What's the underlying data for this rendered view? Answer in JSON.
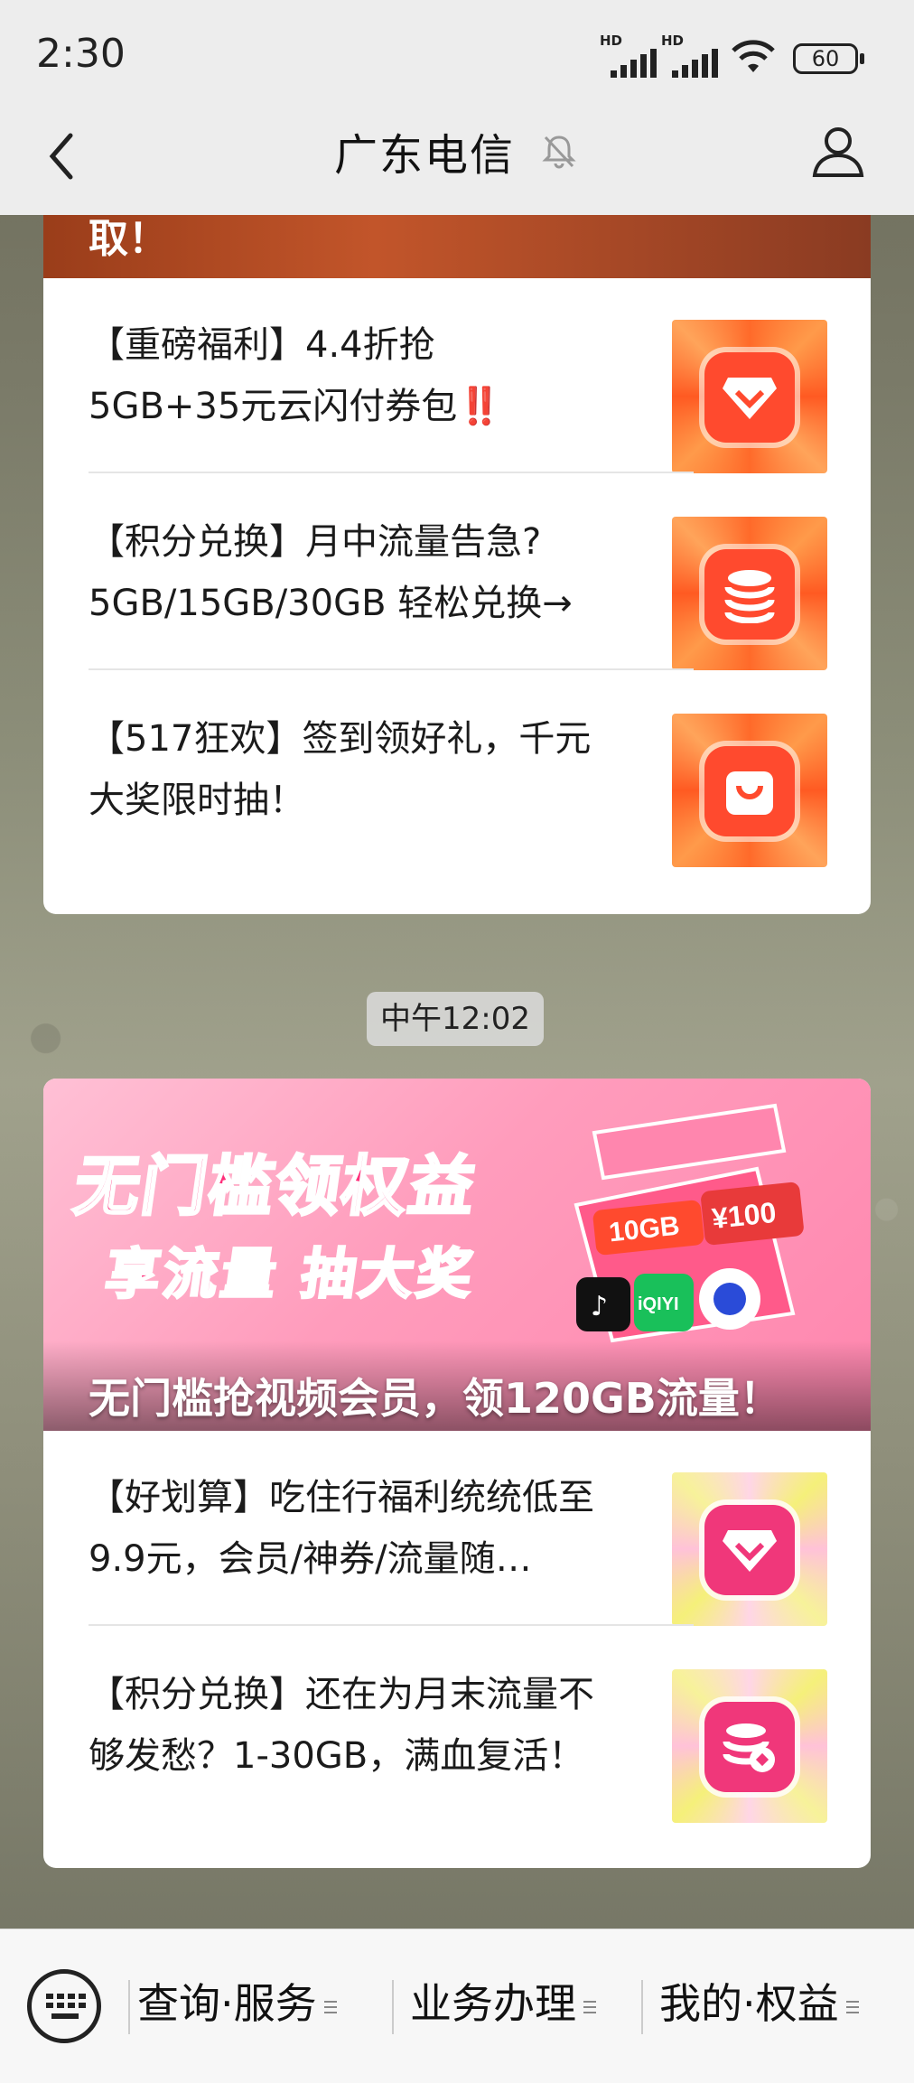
{
  "status_bar": {
    "time": "2:30",
    "signal1_label": "HD",
    "signal2_label": "HD",
    "battery": "60"
  },
  "header": {
    "title": "广东电信",
    "back_icon": "chevron-left-icon",
    "mute_icon": "bell-muted-icon",
    "profile_icon": "user-icon"
  },
  "card1": {
    "top_fragment": "取！",
    "items": [
      {
        "text": "【重磅福利】4.4折抢5GB+35元云闪付券包‼️",
        "line1": "【重磅福利】4.4折抢",
        "line2": "5GB+35元云闪付券包‼️",
        "thumb_icon": "diamond-coupon-icon"
      },
      {
        "text": "【积分兑换】月中流量告急？5GB/15GB/30GB轻松兑换→",
        "line1": "【积分兑换】月中流量告急?",
        "line2": "5GB/15GB/30GB 轻松兑换→",
        "thumb_icon": "coin-stack-icon"
      },
      {
        "text": "【517狂欢】签到领好礼，千元大奖限时抽！",
        "line1": "【517狂欢】签到领好礼，千元",
        "line2": "大奖限时抽！",
        "thumb_icon": "shopping-bag-icon"
      }
    ]
  },
  "timestamp": "中午12:02",
  "card2": {
    "banner": {
      "title": "无门槛领权益",
      "subtitle": "享流量 抽大奖",
      "caption": "无门槛抢视频会员，领120GB流量！",
      "tag_10gb": "10GB",
      "tag_100": "¥100",
      "tag_iqiyi": "iQIYI"
    },
    "items": [
      {
        "line1": "【好划算】吃住行福利统统低至",
        "line2": "9.9元，会员/神券/流量随…",
        "thumb_icon": "diamond-coupon-icon"
      },
      {
        "line1": "【积分兑换】还在为月末流量不",
        "line2": "够发愁？1-30GB，满血复活！",
        "thumb_icon": "coin-stack-icon"
      }
    ]
  },
  "bottom_menu": {
    "keyboard_icon": "keyboard-icon",
    "items": [
      "查询·服务",
      "业务办理",
      "我的·权益"
    ]
  },
  "colors": {
    "accent_pink": "#ff2f7a",
    "thumb_orange": "#ff4a2e",
    "navbar_bg": "#ededed"
  }
}
